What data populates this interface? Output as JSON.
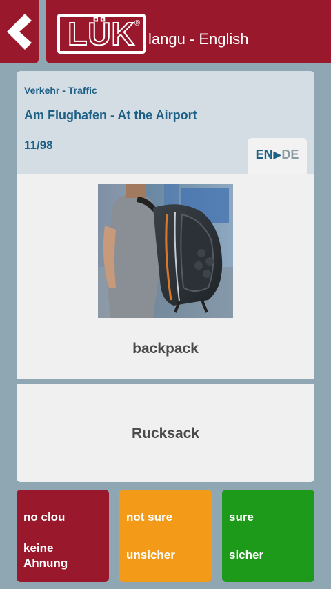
{
  "header": {
    "logo_text": "LÜK",
    "logo_reg": "®",
    "app_title": "langu - English"
  },
  "info": {
    "category": "Verkehr - Traffic",
    "lesson": "Am Flughafen - At the Airport",
    "counter": "11/98",
    "direction": {
      "from": "EN",
      "arrow": "▶",
      "to": "DE"
    }
  },
  "card": {
    "front_word": "backpack",
    "back_word": "Rucksack"
  },
  "answers": [
    {
      "line1": "no clou",
      "line2": "keine\nAhnung"
    },
    {
      "line1": "not sure",
      "line2": "unsicher"
    },
    {
      "line1": "sure",
      "line2": "sicher"
    }
  ],
  "colors": {
    "brand_red": "#99182b",
    "background": "#8fa7b2",
    "accent_blue": "#1e5f86",
    "orange": "#f39a18",
    "green": "#1d9a1a"
  }
}
